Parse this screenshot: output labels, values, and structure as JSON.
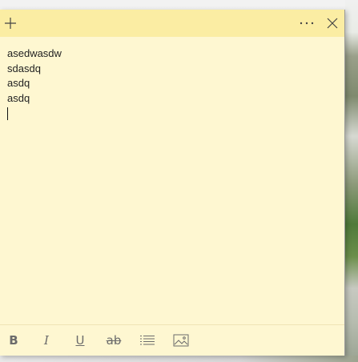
{
  "note": {
    "lines": [
      "asedwasdw",
      "sdasdq",
      "asdq",
      "asdq"
    ],
    "background": "#fef7d1",
    "titlebar_color": "#fbeda3"
  },
  "titlebar": {
    "new_icon": "plus-icon",
    "menu_icon": "ellipsis-icon",
    "close_icon": "close-icon"
  },
  "toolbar": {
    "bold_label": "B",
    "italic_label": "I",
    "underline_label": "U",
    "strike_label": "ab",
    "list_icon": "bulleted-list-icon",
    "image_icon": "image-icon"
  }
}
